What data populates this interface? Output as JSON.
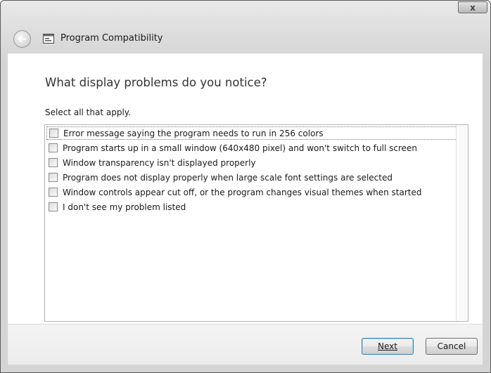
{
  "window": {
    "close_label": "x"
  },
  "nav": {
    "title": "Program Compatibility",
    "back_icon": "back-arrow-icon",
    "app_icon": "program-compatibility-icon"
  },
  "main": {
    "heading": "What display problems do you notice?",
    "instruction": "Select all that apply.",
    "options": [
      {
        "label": "Error message saying the program needs to run in 256 colors",
        "checked": false
      },
      {
        "label": "Program starts up in a small window (640x480 pixel) and won't switch to full screen",
        "checked": false
      },
      {
        "label": "Window transparency isn't displayed properly",
        "checked": false
      },
      {
        "label": "Program does not display properly when large scale font settings are selected",
        "checked": false
      },
      {
        "label": "Window controls appear cut off, or the program changes visual themes when started",
        "checked": false
      },
      {
        "label": "I don't see my problem listed",
        "checked": false
      }
    ]
  },
  "footer": {
    "next_label": "Next",
    "cancel_label": "Cancel"
  }
}
